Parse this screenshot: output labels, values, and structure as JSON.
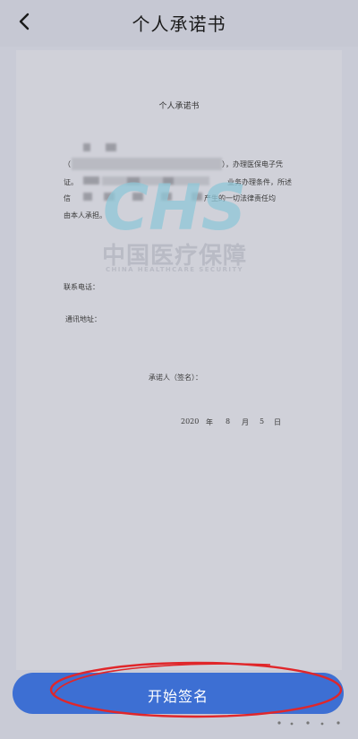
{
  "header": {
    "back_icon": "chevron-left-icon",
    "title": "个人承诺书"
  },
  "document": {
    "title": "个人承诺书",
    "lines": [
      "），办理医保电子凭",
      "证。",
      "业务办理条件，所述",
      "信",
      "产生的一切法律责任均",
      "由本人承担。"
    ],
    "phone_label": "联系电话：",
    "address_label": "通讯地址：",
    "signer_label": "承诺人（签名）：",
    "date": {
      "year": "2020",
      "year_unit": "年",
      "month": "8",
      "month_unit": "月",
      "day": "5",
      "day_unit": "日"
    }
  },
  "watermark": {
    "logo": "CHS",
    "cn_text": "中国医疗保障",
    "en_text": "CHINA HEALTHCARE SECURITY"
  },
  "action": {
    "start_sign_label": "开始签名"
  },
  "colors": {
    "background": "#c9cbd6",
    "button": "#3d6fd3",
    "annotation": "#e0262a",
    "watermark": "#8fc7d8"
  }
}
